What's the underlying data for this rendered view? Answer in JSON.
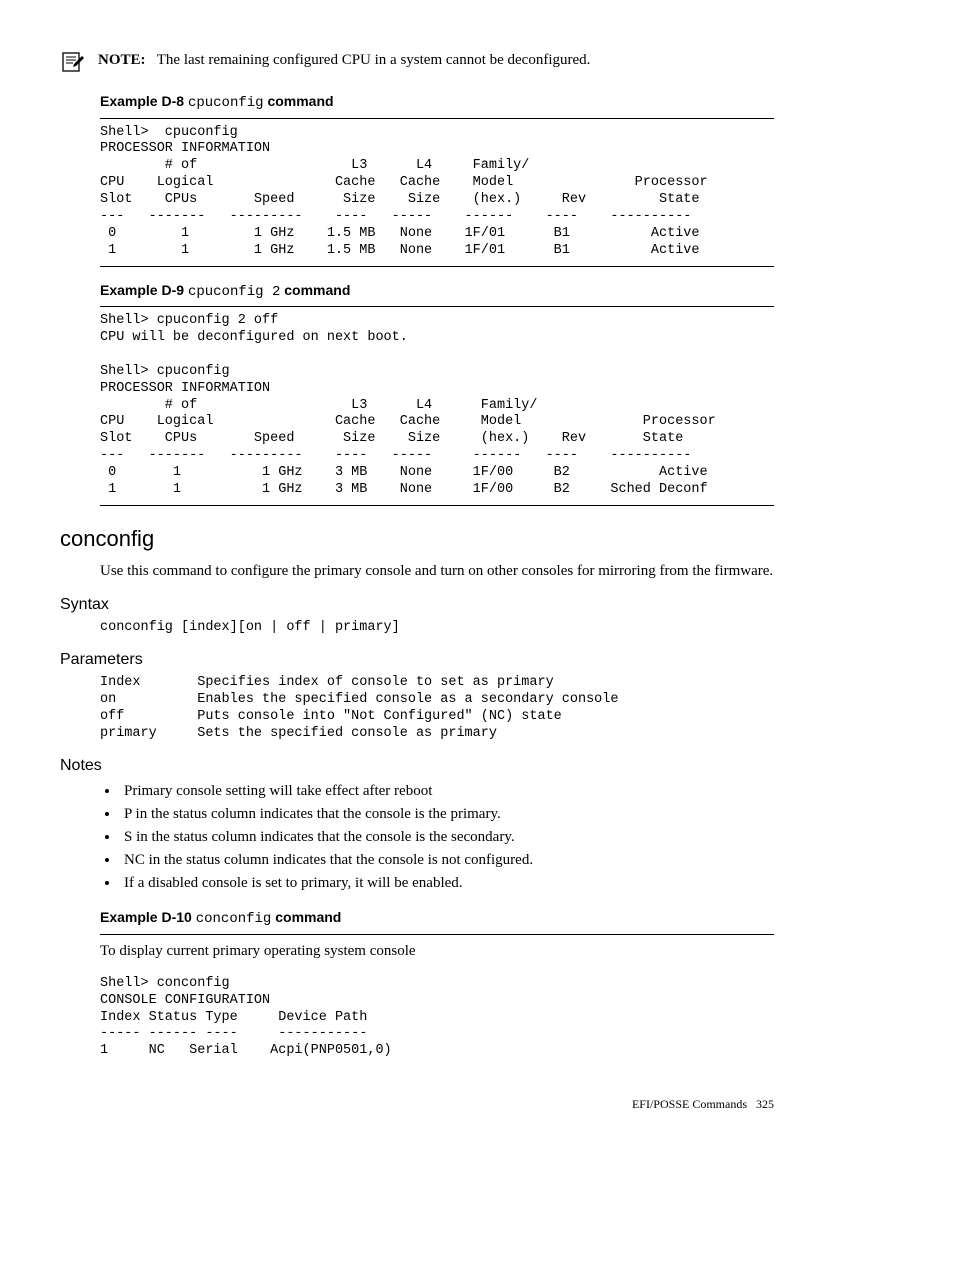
{
  "note": {
    "label": "NOTE:",
    "text": "The last remaining configured CPU in a system cannot be deconfigured."
  },
  "example_d8": {
    "heading_prefix": "Example D-8 ",
    "cmd": "cpuconfig",
    "heading_suffix": " command",
    "code": "Shell>  cpuconfig\nPROCESSOR INFORMATION\n        # of                   L3      L4     Family/\nCPU    Logical               Cache   Cache    Model               Processor\nSlot    CPUs       Speed      Size    Size    (hex.)     Rev         State\n---   -------   ---------    ----   -----    ------    ----    ----------\n 0        1        1 GHz    1.5 MB   None    1F/01      B1          Active\n 1        1        1 GHz    1.5 MB   None    1F/01      B1          Active"
  },
  "example_d9": {
    "heading_prefix": "Example D-9 ",
    "cmd": "cpuconfig 2",
    "heading_suffix": " command",
    "code": "Shell> cpuconfig 2 off\nCPU will be deconfigured on next boot.\n\nShell> cpuconfig\nPROCESSOR INFORMATION\n        # of                   L3      L4      Family/\nCPU    Logical               Cache   Cache     Model               Processor\nSlot    CPUs       Speed      Size    Size     (hex.)    Rev       State\n---   -------   ---------    ----   -----     ------   ----    ----------\n 0       1          1 GHz    3 MB    None     1F/00     B2           Active\n 1       1          1 GHz    3 MB    None     1F/00     B2     Sched Deconf"
  },
  "conconfig": {
    "title": "conconfig",
    "description": "Use this command to configure the primary console and turn on other consoles for mirroring from the firmware."
  },
  "syntax": {
    "title": "Syntax",
    "code": "conconfig [index][on | off | primary]"
  },
  "parameters": {
    "title": "Parameters",
    "code": "Index       Specifies index of console to set as primary\non          Enables the specified console as a secondary console\noff         Puts console into \"Not Configured\" (NC) state\nprimary     Sets the specified console as primary"
  },
  "notes": {
    "title": "Notes",
    "items": [
      "Primary console setting will take effect after reboot",
      "P in the status column indicates that the console is the primary.",
      "S in the status column indicates that the console is the secondary.",
      "NC in the status column indicates that the console is not configured.",
      "If a disabled console is set to primary, it will be enabled."
    ]
  },
  "example_d10": {
    "heading_prefix": "Example D-10 ",
    "cmd": "conconfig",
    "heading_suffix": " command",
    "intro": "To display current primary operating system console",
    "code": "Shell> conconfig\nCONSOLE CONFIGURATION\nIndex Status Type     Device Path\n----- ------ ----     -----------\n1     NC   Serial    Acpi(PNP0501,0)"
  },
  "footer": {
    "text": "EFI/POSSE Commands",
    "page": "325"
  }
}
